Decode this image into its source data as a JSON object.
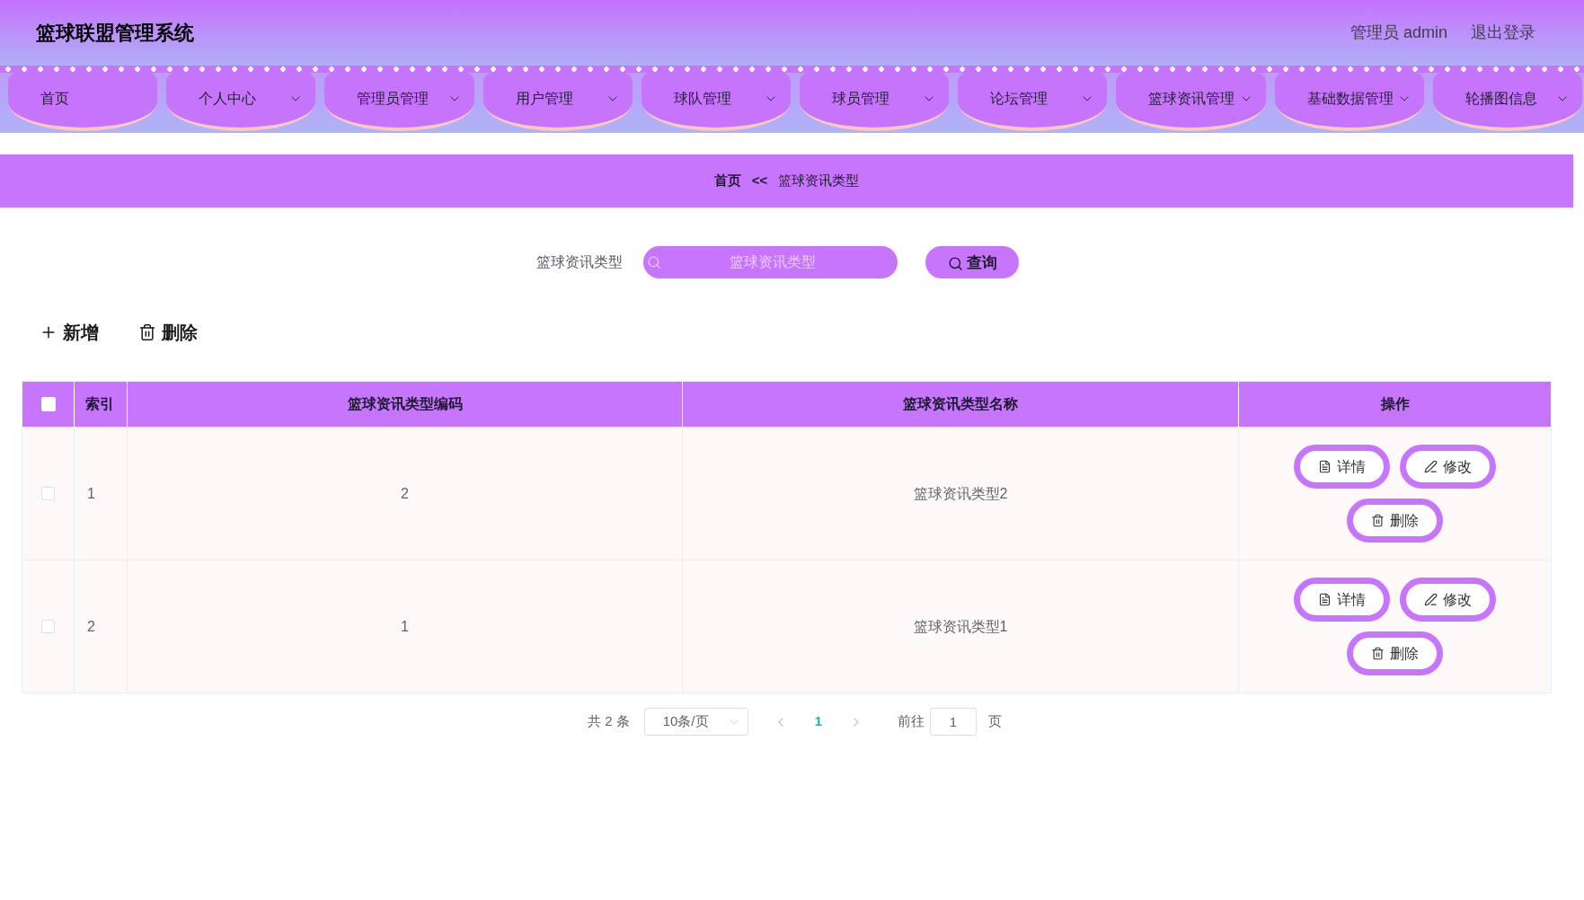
{
  "header": {
    "title": "篮球联盟管理系统",
    "user": "管理员 admin",
    "logout": "退出登录"
  },
  "nav": [
    {
      "label": "首页",
      "dropdown": false
    },
    {
      "label": "个人中心",
      "dropdown": true
    },
    {
      "label": "管理员管理",
      "dropdown": true
    },
    {
      "label": "用户管理",
      "dropdown": true
    },
    {
      "label": "球队管理",
      "dropdown": true
    },
    {
      "label": "球员管理",
      "dropdown": true
    },
    {
      "label": "论坛管理",
      "dropdown": true
    },
    {
      "label": "篮球资讯管理",
      "dropdown": true
    },
    {
      "label": "基础数据管理",
      "dropdown": true
    },
    {
      "label": "轮播图信息",
      "dropdown": true
    }
  ],
  "breadcrumb": [
    {
      "kind": "link",
      "label": "首页"
    },
    {
      "kind": "separator",
      "label": "<<"
    },
    {
      "kind": "current",
      "label": "篮球资讯类型"
    }
  ],
  "search": {
    "label": "篮球资讯类型",
    "placeholder": "篮球资讯类型",
    "button": "查询"
  },
  "actions": [
    {
      "kind": "add",
      "label": "新增"
    },
    {
      "kind": "delete",
      "label": "删除"
    }
  ],
  "table": {
    "header_checkbox": {
      "checked": false
    },
    "columns": [
      {
        "label": "索引"
      },
      {
        "label": "篮球资讯类型编码"
      },
      {
        "label": "篮球资讯类型名称"
      },
      {
        "label": "操作"
      }
    ],
    "rows": [
      {
        "checked": false,
        "index": "1",
        "code": "2",
        "name": "篮球资讯类型2",
        "actions": [
          {
            "kind": "detail",
            "label": "详情"
          },
          {
            "kind": "edit",
            "label": "修改"
          },
          {
            "kind": "delete",
            "label": "删除"
          }
        ]
      },
      {
        "checked": false,
        "index": "2",
        "code": "1",
        "name": "篮球资讯类型1",
        "actions": [
          {
            "kind": "detail",
            "label": "详情"
          },
          {
            "kind": "edit",
            "label": "修改"
          },
          {
            "kind": "delete",
            "label": "删除"
          }
        ]
      }
    ]
  },
  "pagination": {
    "total": "共 2 条",
    "page_size": "10条/页",
    "pages": [
      {
        "label": "1",
        "selected": true
      }
    ],
    "goto_label": "前往",
    "goto_value": "1",
    "page_suffix": "页"
  }
}
